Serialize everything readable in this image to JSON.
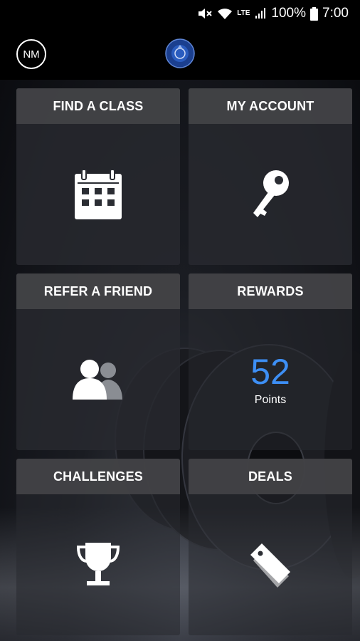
{
  "status_bar": {
    "battery": "100%",
    "time": "7:00",
    "network": "LTE",
    "icons": [
      "mute-icon",
      "wifi-icon",
      "lte-icon",
      "signal-icon",
      "battery-icon"
    ]
  },
  "header": {
    "avatar_initials": "NM",
    "logo_icon": "campus-fitness-logo"
  },
  "tiles": [
    {
      "title": "FIND A CLASS",
      "icon": "calendar-icon"
    },
    {
      "title": "MY ACCOUNT",
      "icon": "key-icon"
    },
    {
      "title": "REFER A FRIEND",
      "icon": "users-icon"
    },
    {
      "title": "REWARDS",
      "points_value": "52",
      "points_label": "Points"
    },
    {
      "title": "CHALLENGES",
      "icon": "trophy-icon"
    },
    {
      "title": "DEALS",
      "icon": "tag-icon"
    }
  ],
  "colors": {
    "accent": "#3d8ff5",
    "tile_header": "#424246",
    "background": "#0b0c10"
  }
}
